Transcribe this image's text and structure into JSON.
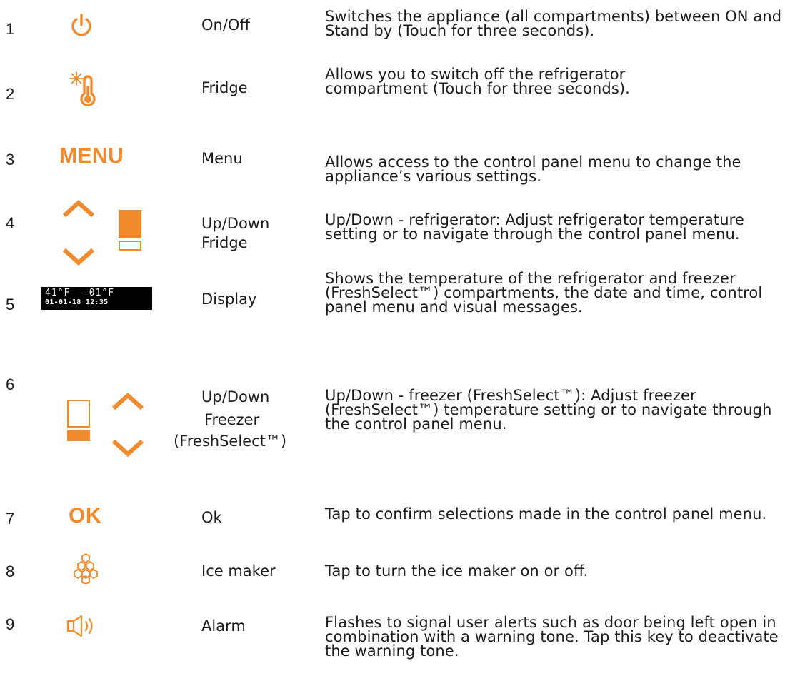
{
  "accent_color": "#f08a2c",
  "rows": [
    {
      "num": "1",
      "icon": "power-icon",
      "name": "On/Off",
      "desc": "Switches the appliance (all compartments) between ON and Stand by (Touch for three seconds)."
    },
    {
      "num": "2",
      "icon": "snowflake-thermometer-icon",
      "name": "Fridge",
      "desc": "Allows you to switch off the refrigerator compartment (Touch for three seconds)."
    },
    {
      "num": "3",
      "icon_text": "MENU",
      "name": "Menu",
      "desc": "Allows access to the control panel menu to change the appliance’s various settings."
    },
    {
      "num": "4",
      "icon": "up-down-fridge-icon",
      "name": "Up/Down Fridge",
      "desc": "Up/Down - refrigerator:  Adjust refrigerator temperature setting or to navigate through the control panel menu."
    },
    {
      "num": "5",
      "icon": "display-icon",
      "name": "Display",
      "display_line1": "41°F  -01°F",
      "display_line2": "01-01-18 12:35",
      "desc": "Shows the temperature of the refrigerator and freezer (FreshSelect™) compartments, the date and time, control panel menu and visual messages."
    },
    {
      "num": "6",
      "icon": "up-down-freezer-icon",
      "name_line1": "Up/Down",
      "name_line2": "Freezer",
      "name_line3": "(FreshSelect™)",
      "desc": "Up/Down - freezer (FreshSelect™): Adjust freezer (FreshSelect™) temperature setting or to navigate through the control panel menu."
    },
    {
      "num": "7",
      "icon_text": "OK",
      "name": "Ok",
      "desc": "Tap to confirm selections made in the control panel menu."
    },
    {
      "num": "8",
      "icon": "ice-maker-icon",
      "name": "Ice maker",
      "desc": "Tap to turn the ice maker on or off."
    },
    {
      "num": "9",
      "icon": "alarm-speaker-icon",
      "name": "Alarm",
      "desc": "Flashes to signal user alerts such as door being left open in combination with a warning tone. Tap this key to deactivate the warning tone."
    }
  ]
}
